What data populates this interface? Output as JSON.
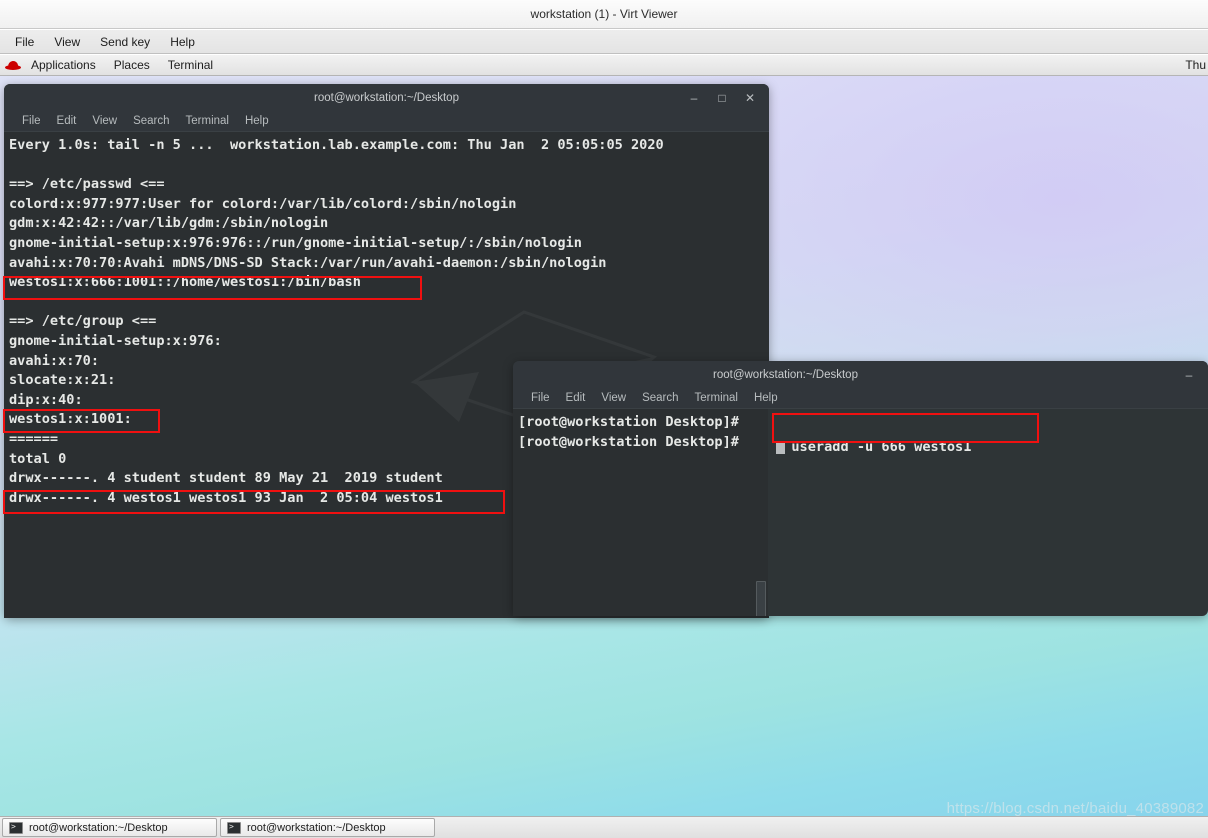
{
  "window": {
    "title": "workstation (1) - Virt Viewer",
    "menus": [
      "File",
      "View",
      "Send key",
      "Help"
    ]
  },
  "gnome_panel": {
    "logo_icon": "redhat-icon",
    "items": [
      "Applications",
      "Places",
      "Terminal"
    ],
    "clock": "Thu"
  },
  "terminal1": {
    "title": "root@workstation:~/Desktop",
    "menus": [
      "File",
      "Edit",
      "View",
      "Search",
      "Terminal",
      "Help"
    ],
    "window_buttons": {
      "minimize": "–",
      "maximize": "□",
      "close": "✕"
    },
    "lines": [
      "Every 1.0s: tail -n 5 ...  workstation.lab.example.com: Thu Jan  2 05:05:05 2020",
      "",
      "==> /etc/passwd <==",
      "colord:x:977:977:User for colord:/var/lib/colord:/sbin/nologin",
      "gdm:x:42:42::/var/lib/gdm:/sbin/nologin",
      "gnome-initial-setup:x:976:976::/run/gnome-initial-setup/:/sbin/nologin",
      "avahi:x:70:70:Avahi mDNS/DNS-SD Stack:/var/run/avahi-daemon:/sbin/nologin",
      "westos1:x:666:1001::/home/westos1:/bin/bash",
      "",
      "==> /etc/group <==",
      "gnome-initial-setup:x:976:",
      "avahi:x:70:",
      "slocate:x:21:",
      "dip:x:40:",
      "westos1:x:1001:",
      "======",
      "total 0",
      "drwx------. 4 student student 89 May 21  2019 student",
      "drwx------. 4 westos1 westos1 93 Jan  2 05:04 westos1"
    ]
  },
  "terminal2": {
    "title": "root@workstation:~/Desktop",
    "menus": [
      "File",
      "Edit",
      "View",
      "Search",
      "Terminal",
      "Help"
    ],
    "window_buttons": {
      "minimize": "–"
    },
    "prompt": "[root@workstation Desktop]# ",
    "command": "useradd -u 666 westos1",
    "prompt2": "[root@workstation Desktop]# "
  },
  "annotations": {
    "highlight_color": "#f01010",
    "boxes": [
      {
        "label": "passwd-westos1-entry"
      },
      {
        "label": "group-westos1-entry"
      },
      {
        "label": "home-dir-westos1-entry"
      },
      {
        "label": "useradd-command"
      }
    ]
  },
  "taskbar": {
    "items": [
      {
        "label": "root@workstation:~/Desktop",
        "icon": "terminal-icon"
      },
      {
        "label": "root@workstation:~/Desktop",
        "icon": "terminal-icon"
      }
    ]
  },
  "watermark": "https://blog.csdn.net/baidu_40389082"
}
